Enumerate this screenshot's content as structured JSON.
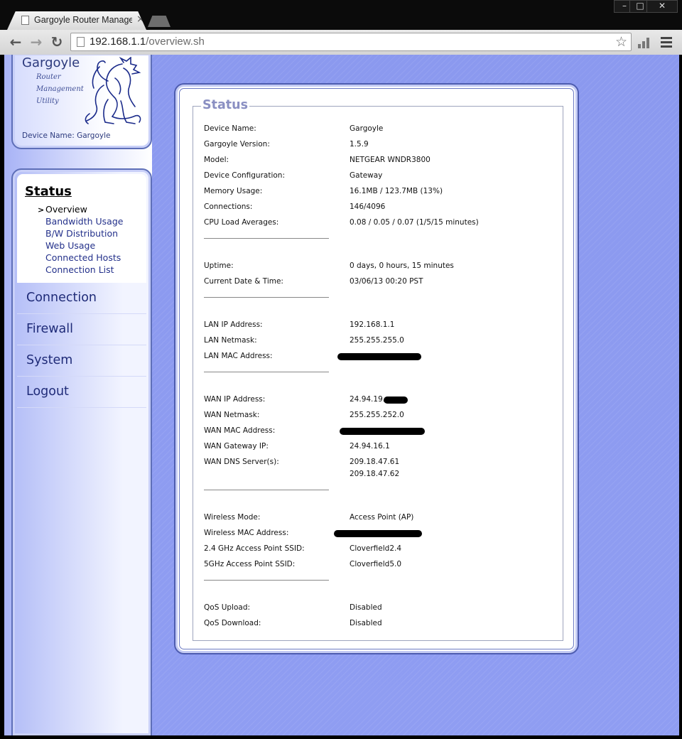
{
  "browser": {
    "tab_title": "Gargoyle Router Managem",
    "url_host": "192.168.1.1",
    "url_path": "/overview.sh",
    "window_controls": [
      "–",
      "□",
      "✕"
    ]
  },
  "logo": {
    "title": "Gargoyle",
    "subtitle": [
      "Router",
      "Management",
      "Utility"
    ],
    "device_name": "Device Name: Gargoyle"
  },
  "nav": {
    "active_section": "Status",
    "status_items": [
      "Overview",
      "Bandwidth Usage",
      "B/W Distribution",
      "Web Usage",
      "Connected Hosts",
      "Connection List"
    ],
    "current_item": "Overview",
    "sections": [
      "Connection",
      "Firewall",
      "System",
      "Logout"
    ]
  },
  "status": {
    "legend": "Status",
    "groups": [
      [
        {
          "label": "Device Name:",
          "value": "Gargoyle"
        },
        {
          "label": "Gargoyle Version:",
          "value": "1.5.9"
        },
        {
          "label": "Model:",
          "value": "NETGEAR WNDR3800"
        },
        {
          "label": "Device Configuration:",
          "value": "Gateway"
        },
        {
          "label": "Memory Usage:",
          "value": "16.1MB / 123.7MB (13%)"
        },
        {
          "label": "Connections:",
          "value": "146/4096"
        },
        {
          "label": "CPU Load Averages:",
          "value": "0.08 / 0.05 / 0.07  (1/5/15 minutes)"
        }
      ],
      [
        {
          "label": "Uptime:",
          "value": "0 days, 0 hours, 15 minutes"
        },
        {
          "label": "Current Date & Time:",
          "value": "03/06/13 00:20 PST"
        }
      ],
      [
        {
          "label": "LAN IP Address:",
          "value": "192.168.1.1"
        },
        {
          "label": "LAN Netmask:",
          "value": "255.255.255.0"
        },
        {
          "label": "LAN MAC Address:",
          "value": ""
        }
      ],
      [
        {
          "label": "WAN IP Address:",
          "value": "24.94.19."
        },
        {
          "label": "WAN Netmask:",
          "value": "255.255.252.0"
        },
        {
          "label": "WAN MAC Address:",
          "value": ""
        },
        {
          "label": "WAN Gateway IP:",
          "value": "24.94.16.1"
        },
        {
          "label": "WAN DNS Server(s):",
          "value": "209.18.47.61"
        },
        {
          "label": "",
          "value": "209.18.47.62"
        }
      ],
      [
        {
          "label": "Wireless Mode:",
          "value": "Access Point (AP)"
        },
        {
          "label": "Wireless MAC Address:",
          "value": ""
        },
        {
          "label": "2.4 GHz Access Point SSID:",
          "value": "Cloverfield2.4"
        },
        {
          "label": "5GHz Access Point SSID:",
          "value": "Cloverfield5.0"
        }
      ],
      [
        {
          "label": "QoS Upload:",
          "value": "Disabled"
        },
        {
          "label": "QoS Download:",
          "value": "Disabled"
        }
      ]
    ]
  }
}
